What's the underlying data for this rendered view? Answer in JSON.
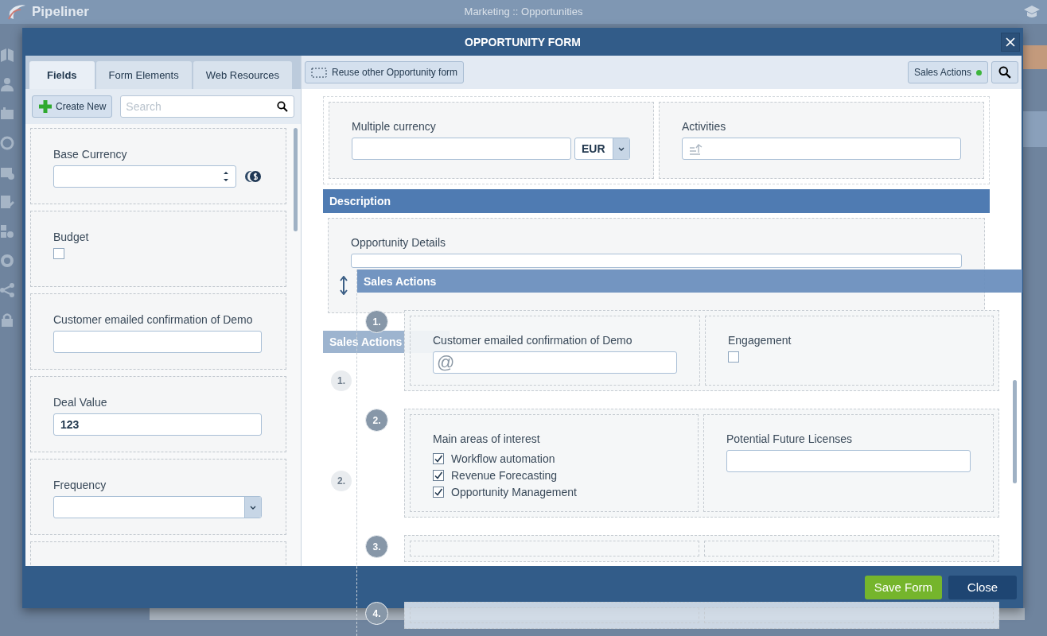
{
  "app": {
    "logo": "Pipeliner",
    "breadcrumb": "Marketing :: Opportunities"
  },
  "dialog": {
    "title": "OPPORTUNITY FORM"
  },
  "left_panel": {
    "tabs": [
      {
        "label": "Fields",
        "selected": true
      },
      {
        "label": "Form Elements",
        "selected": false
      },
      {
        "label": "Web Resources",
        "selected": false
      }
    ],
    "create_button": "Create New",
    "search": {
      "placeholder": "Search"
    },
    "fields": [
      {
        "kind": "spinner",
        "label": "Base Currency"
      },
      {
        "kind": "checkbox",
        "label": "Budget",
        "checked": false
      },
      {
        "kind": "text",
        "label": "Customer emailed confirmation of Demo"
      },
      {
        "kind": "text",
        "label": "Deal Value",
        "value": "123"
      },
      {
        "kind": "select",
        "label": "Frequency"
      },
      {
        "kind": "empty"
      }
    ]
  },
  "toolbar": {
    "reuse_button": "Reuse other Opportunity form",
    "sales_actions_button": {
      "label": "Sales Actions",
      "on": true
    }
  },
  "form": {
    "row": [
      {
        "kind": "currency",
        "label": "Multiple currency",
        "currency": "EUR"
      },
      {
        "kind": "activities",
        "label": "Activities"
      }
    ],
    "section": {
      "title": "Description",
      "field": "Opportunity Details"
    },
    "ghost_section": {
      "title": "Sales Actions",
      "steps": [
        "1.",
        "2."
      ]
    }
  },
  "drag_overlay": {
    "title": "Sales Actions",
    "steps": [
      {
        "number": "1.",
        "fields": [
          {
            "kind": "email",
            "label": "Customer emailed confirmation of Demo",
            "symbol": "@"
          },
          {
            "kind": "checkbox",
            "label": "Engagement",
            "checked": false
          }
        ]
      },
      {
        "number": "2.",
        "fields": [
          {
            "kind": "checklist",
            "label": "Main areas of interest",
            "options": [
              {
                "label": "Workflow automation",
                "checked": true
              },
              {
                "label": "Revenue Forecasting",
                "checked": true
              },
              {
                "label": "Opportunity Management",
                "checked": true
              }
            ]
          },
          {
            "kind": "text",
            "label": "Potential Future Licenses"
          }
        ]
      },
      {
        "number": "3.",
        "fields": [
          {
            "kind": "empty"
          },
          {
            "kind": "empty"
          }
        ]
      },
      {
        "number": "4.",
        "fields": [
          {
            "kind": "empty"
          },
          {
            "kind": "empty"
          }
        ]
      }
    ]
  },
  "footer": {
    "buttons": [
      {
        "label": "Save Form",
        "kind": "primary"
      },
      {
        "label": "Close",
        "kind": "secondary"
      }
    ]
  }
}
